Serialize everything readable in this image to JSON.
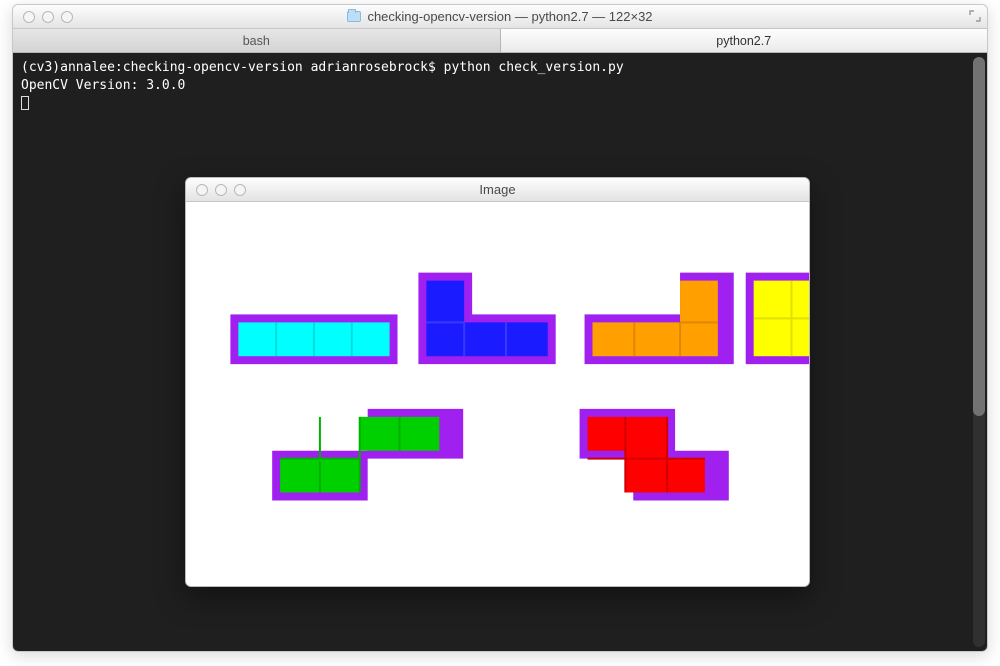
{
  "terminal": {
    "window_title": "checking-opencv-version — python2.7 — 122×32",
    "tabs": [
      {
        "label": "bash",
        "active": false
      },
      {
        "label": "python2.7",
        "active": true
      }
    ],
    "prompt_line": "(cv3)annalee:checking-opencv-version adrianrosebrock$ python check_version.py",
    "output_line": "OpenCV Version: 3.0.0"
  },
  "image_window": {
    "title": "Image",
    "outline_color": "#a020f0",
    "shapes": [
      {
        "name": "I-piece",
        "color": "#00ffff"
      },
      {
        "name": "J-piece",
        "color": "#1b1bff"
      },
      {
        "name": "L-piece",
        "color": "#ff9f00"
      },
      {
        "name": "O-piece",
        "color": "#ffff00"
      },
      {
        "name": "S-piece",
        "color": "#00d000"
      },
      {
        "name": "Z-piece",
        "color": "#ff0000"
      }
    ]
  }
}
